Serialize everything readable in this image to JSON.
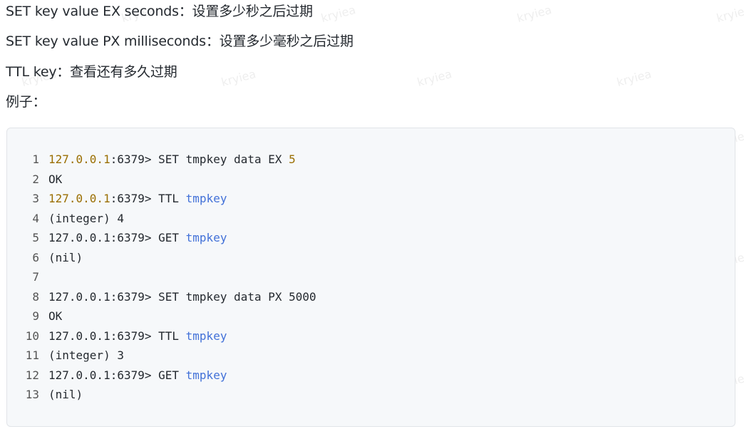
{
  "paragraphs": [
    "SET key value EX seconds：设置多少秒之后过期",
    "SET key value PX milliseconds：设置多少毫秒之后过期",
    "TTL key：查看还有多久过期",
    "例子："
  ],
  "code": {
    "lines": [
      {
        "n": "1",
        "tokens": [
          {
            "t": "127.0.0.1",
            "c": "num"
          },
          {
            "t": ":6379> SET tmpkey data EX ",
            "c": ""
          },
          {
            "t": "5",
            "c": "num"
          }
        ]
      },
      {
        "n": "2",
        "tokens": [
          {
            "t": "OK",
            "c": ""
          }
        ]
      },
      {
        "n": "3",
        "tokens": [
          {
            "t": "127.0.0.1",
            "c": "num"
          },
          {
            "t": ":6379> TTL ",
            "c": ""
          },
          {
            "t": "tmpkey",
            "c": "kw"
          }
        ]
      },
      {
        "n": "4",
        "tokens": [
          {
            "t": "(integer) 4",
            "c": ""
          }
        ]
      },
      {
        "n": "5",
        "tokens": [
          {
            "t": "127.0.0.1:6379> GET ",
            "c": ""
          },
          {
            "t": "tmpkey",
            "c": "kw"
          }
        ]
      },
      {
        "n": "6",
        "tokens": [
          {
            "t": "(nil)",
            "c": ""
          }
        ]
      },
      {
        "n": "7",
        "tokens": []
      },
      {
        "n": "8",
        "tokens": [
          {
            "t": "127.0.0.1:6379> SET tmpkey data PX 5000",
            "c": ""
          }
        ]
      },
      {
        "n": "9",
        "tokens": [
          {
            "t": "OK",
            "c": ""
          }
        ]
      },
      {
        "n": "10",
        "tokens": [
          {
            "t": "127.0.0.1:6379> TTL ",
            "c": ""
          },
          {
            "t": "tmpkey",
            "c": "kw"
          }
        ]
      },
      {
        "n": "11",
        "tokens": [
          {
            "t": "(integer) 3",
            "c": ""
          }
        ]
      },
      {
        "n": "12",
        "tokens": [
          {
            "t": "127.0.0.1:6379> GET ",
            "c": ""
          },
          {
            "t": "tmpkey",
            "c": "kw"
          }
        ]
      },
      {
        "n": "13",
        "tokens": [
          {
            "t": "(nil)",
            "c": ""
          }
        ]
      }
    ]
  },
  "watermark": "kryiea",
  "colors": {
    "number_token": "#9a6e00",
    "keyword_token": "#4271d8",
    "code_background": "#f6f8fa"
  }
}
